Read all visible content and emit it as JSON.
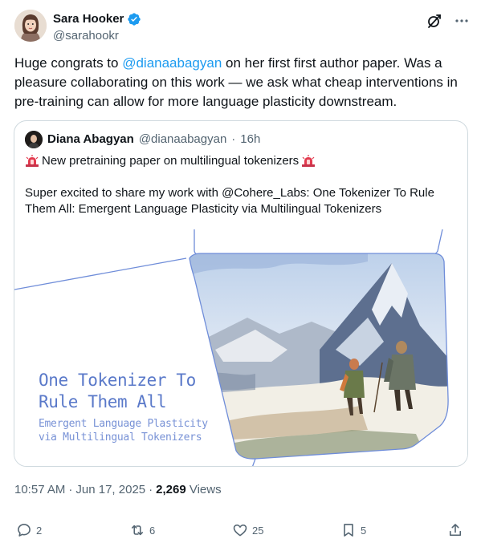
{
  "author": {
    "display_name": "Sara Hooker",
    "handle": "@sarahookr",
    "verified": true,
    "avatar_icon": "avatar-illustration-icon"
  },
  "header_actions": [
    {
      "name": "grok-icon"
    },
    {
      "name": "more-icon",
      "glyph": "···"
    }
  ],
  "tweet": {
    "text_before": "Huge congrats to ",
    "mention": "@dianaabagyan",
    "text_after": " on her first first author paper. Was a pleasure collaborating on this work — we ask what cheap interventions in pre-training can allow for more language plasticity downstream."
  },
  "quote": {
    "display_name": "Diana Abagyan",
    "handle": "@dianaabagyan",
    "separator": "·",
    "time": "16h",
    "line1": "New pretraining paper on multilingual tokenizers",
    "line2": "Super excited to share my work with @Cohere_Labs: One Tokenizer To Rule Them All: Emergent Language Plasticity via Multilingual Tokenizers",
    "image": {
      "title_line1": "One Tokenizer To",
      "title_line2": "Rule Them All",
      "sub_line1": "Emergent Language Plasticity",
      "sub_line2": "via Multilingual Tokenizers"
    }
  },
  "meta": {
    "time": "10:57 AM",
    "dot1": "·",
    "date": "Jun 17, 2025",
    "dot2": "·",
    "views_count": "2,269",
    "views_label": "Views"
  },
  "actions": {
    "replies": "2",
    "reposts": "6",
    "likes": "25",
    "bookmarks": "5"
  },
  "colors": {
    "accent": "#1d9bf0",
    "muted": "#536471",
    "border": "#cfd9de",
    "image_title": "#5a79c9"
  }
}
